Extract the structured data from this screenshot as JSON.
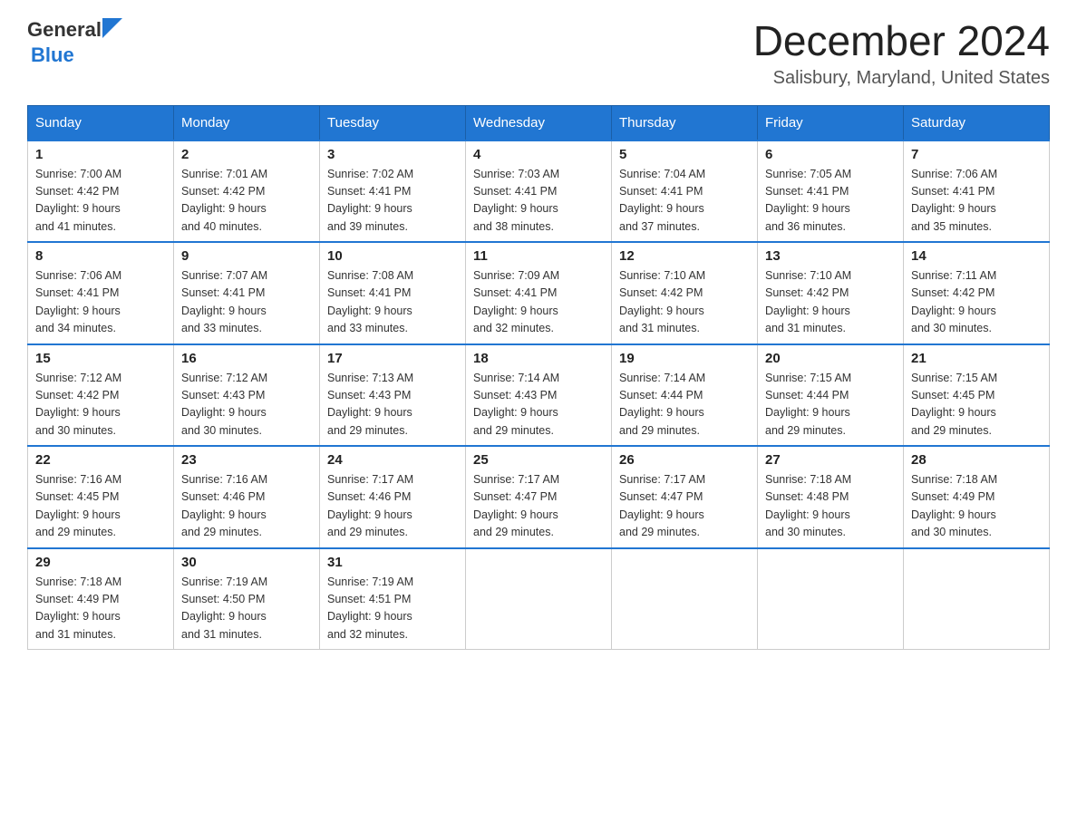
{
  "header": {
    "logo_general": "General",
    "logo_blue": "Blue",
    "title": "December 2024",
    "subtitle": "Salisbury, Maryland, United States"
  },
  "days_of_week": [
    "Sunday",
    "Monday",
    "Tuesday",
    "Wednesday",
    "Thursday",
    "Friday",
    "Saturday"
  ],
  "weeks": [
    [
      {
        "day": "1",
        "sunrise": "7:00 AM",
        "sunset": "4:42 PM",
        "daylight": "9 hours and 41 minutes."
      },
      {
        "day": "2",
        "sunrise": "7:01 AM",
        "sunset": "4:42 PM",
        "daylight": "9 hours and 40 minutes."
      },
      {
        "day": "3",
        "sunrise": "7:02 AM",
        "sunset": "4:41 PM",
        "daylight": "9 hours and 39 minutes."
      },
      {
        "day": "4",
        "sunrise": "7:03 AM",
        "sunset": "4:41 PM",
        "daylight": "9 hours and 38 minutes."
      },
      {
        "day": "5",
        "sunrise": "7:04 AM",
        "sunset": "4:41 PM",
        "daylight": "9 hours and 37 minutes."
      },
      {
        "day": "6",
        "sunrise": "7:05 AM",
        "sunset": "4:41 PM",
        "daylight": "9 hours and 36 minutes."
      },
      {
        "day": "7",
        "sunrise": "7:06 AM",
        "sunset": "4:41 PM",
        "daylight": "9 hours and 35 minutes."
      }
    ],
    [
      {
        "day": "8",
        "sunrise": "7:06 AM",
        "sunset": "4:41 PM",
        "daylight": "9 hours and 34 minutes."
      },
      {
        "day": "9",
        "sunrise": "7:07 AM",
        "sunset": "4:41 PM",
        "daylight": "9 hours and 33 minutes."
      },
      {
        "day": "10",
        "sunrise": "7:08 AM",
        "sunset": "4:41 PM",
        "daylight": "9 hours and 33 minutes."
      },
      {
        "day": "11",
        "sunrise": "7:09 AM",
        "sunset": "4:41 PM",
        "daylight": "9 hours and 32 minutes."
      },
      {
        "day": "12",
        "sunrise": "7:10 AM",
        "sunset": "4:42 PM",
        "daylight": "9 hours and 31 minutes."
      },
      {
        "day": "13",
        "sunrise": "7:10 AM",
        "sunset": "4:42 PM",
        "daylight": "9 hours and 31 minutes."
      },
      {
        "day": "14",
        "sunrise": "7:11 AM",
        "sunset": "4:42 PM",
        "daylight": "9 hours and 30 minutes."
      }
    ],
    [
      {
        "day": "15",
        "sunrise": "7:12 AM",
        "sunset": "4:42 PM",
        "daylight": "9 hours and 30 minutes."
      },
      {
        "day": "16",
        "sunrise": "7:12 AM",
        "sunset": "4:43 PM",
        "daylight": "9 hours and 30 minutes."
      },
      {
        "day": "17",
        "sunrise": "7:13 AM",
        "sunset": "4:43 PM",
        "daylight": "9 hours and 29 minutes."
      },
      {
        "day": "18",
        "sunrise": "7:14 AM",
        "sunset": "4:43 PM",
        "daylight": "9 hours and 29 minutes."
      },
      {
        "day": "19",
        "sunrise": "7:14 AM",
        "sunset": "4:44 PM",
        "daylight": "9 hours and 29 minutes."
      },
      {
        "day": "20",
        "sunrise": "7:15 AM",
        "sunset": "4:44 PM",
        "daylight": "9 hours and 29 minutes."
      },
      {
        "day": "21",
        "sunrise": "7:15 AM",
        "sunset": "4:45 PM",
        "daylight": "9 hours and 29 minutes."
      }
    ],
    [
      {
        "day": "22",
        "sunrise": "7:16 AM",
        "sunset": "4:45 PM",
        "daylight": "9 hours and 29 minutes."
      },
      {
        "day": "23",
        "sunrise": "7:16 AM",
        "sunset": "4:46 PM",
        "daylight": "9 hours and 29 minutes."
      },
      {
        "day": "24",
        "sunrise": "7:17 AM",
        "sunset": "4:46 PM",
        "daylight": "9 hours and 29 minutes."
      },
      {
        "day": "25",
        "sunrise": "7:17 AM",
        "sunset": "4:47 PM",
        "daylight": "9 hours and 29 minutes."
      },
      {
        "day": "26",
        "sunrise": "7:17 AM",
        "sunset": "4:47 PM",
        "daylight": "9 hours and 29 minutes."
      },
      {
        "day": "27",
        "sunrise": "7:18 AM",
        "sunset": "4:48 PM",
        "daylight": "9 hours and 30 minutes."
      },
      {
        "day": "28",
        "sunrise": "7:18 AM",
        "sunset": "4:49 PM",
        "daylight": "9 hours and 30 minutes."
      }
    ],
    [
      {
        "day": "29",
        "sunrise": "7:18 AM",
        "sunset": "4:49 PM",
        "daylight": "9 hours and 31 minutes."
      },
      {
        "day": "30",
        "sunrise": "7:19 AM",
        "sunset": "4:50 PM",
        "daylight": "9 hours and 31 minutes."
      },
      {
        "day": "31",
        "sunrise": "7:19 AM",
        "sunset": "4:51 PM",
        "daylight": "9 hours and 32 minutes."
      },
      null,
      null,
      null,
      null
    ]
  ],
  "labels": {
    "sunrise": "Sunrise:",
    "sunset": "Sunset:",
    "daylight": "Daylight:"
  }
}
